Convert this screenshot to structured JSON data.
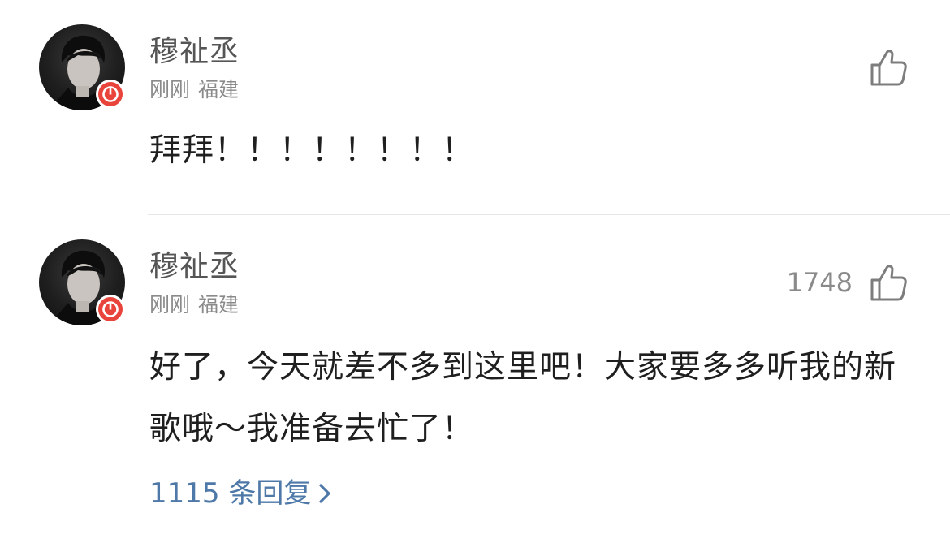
{
  "comments": [
    {
      "username": "穆祉丞",
      "time": "刚刚",
      "location": "福建",
      "like_count": "",
      "text": "拜拜！！！！！！！！"
    },
    {
      "username": "穆祉丞",
      "time": "刚刚",
      "location": "福建",
      "like_count": "1748",
      "text": "好了，今天就差不多到这里吧！大家要多多听我的新歌哦～我准备去忙了！",
      "replies_label": "1115 条回复"
    }
  ],
  "colors": {
    "badge": "#e9443c",
    "reply_link": "#4e78a8",
    "meta": "#8a8a8a"
  },
  "icons": {
    "like": "thumbs-up-icon",
    "badge": "music-badge-icon",
    "reply_arrow": "chevron-right-icon"
  }
}
